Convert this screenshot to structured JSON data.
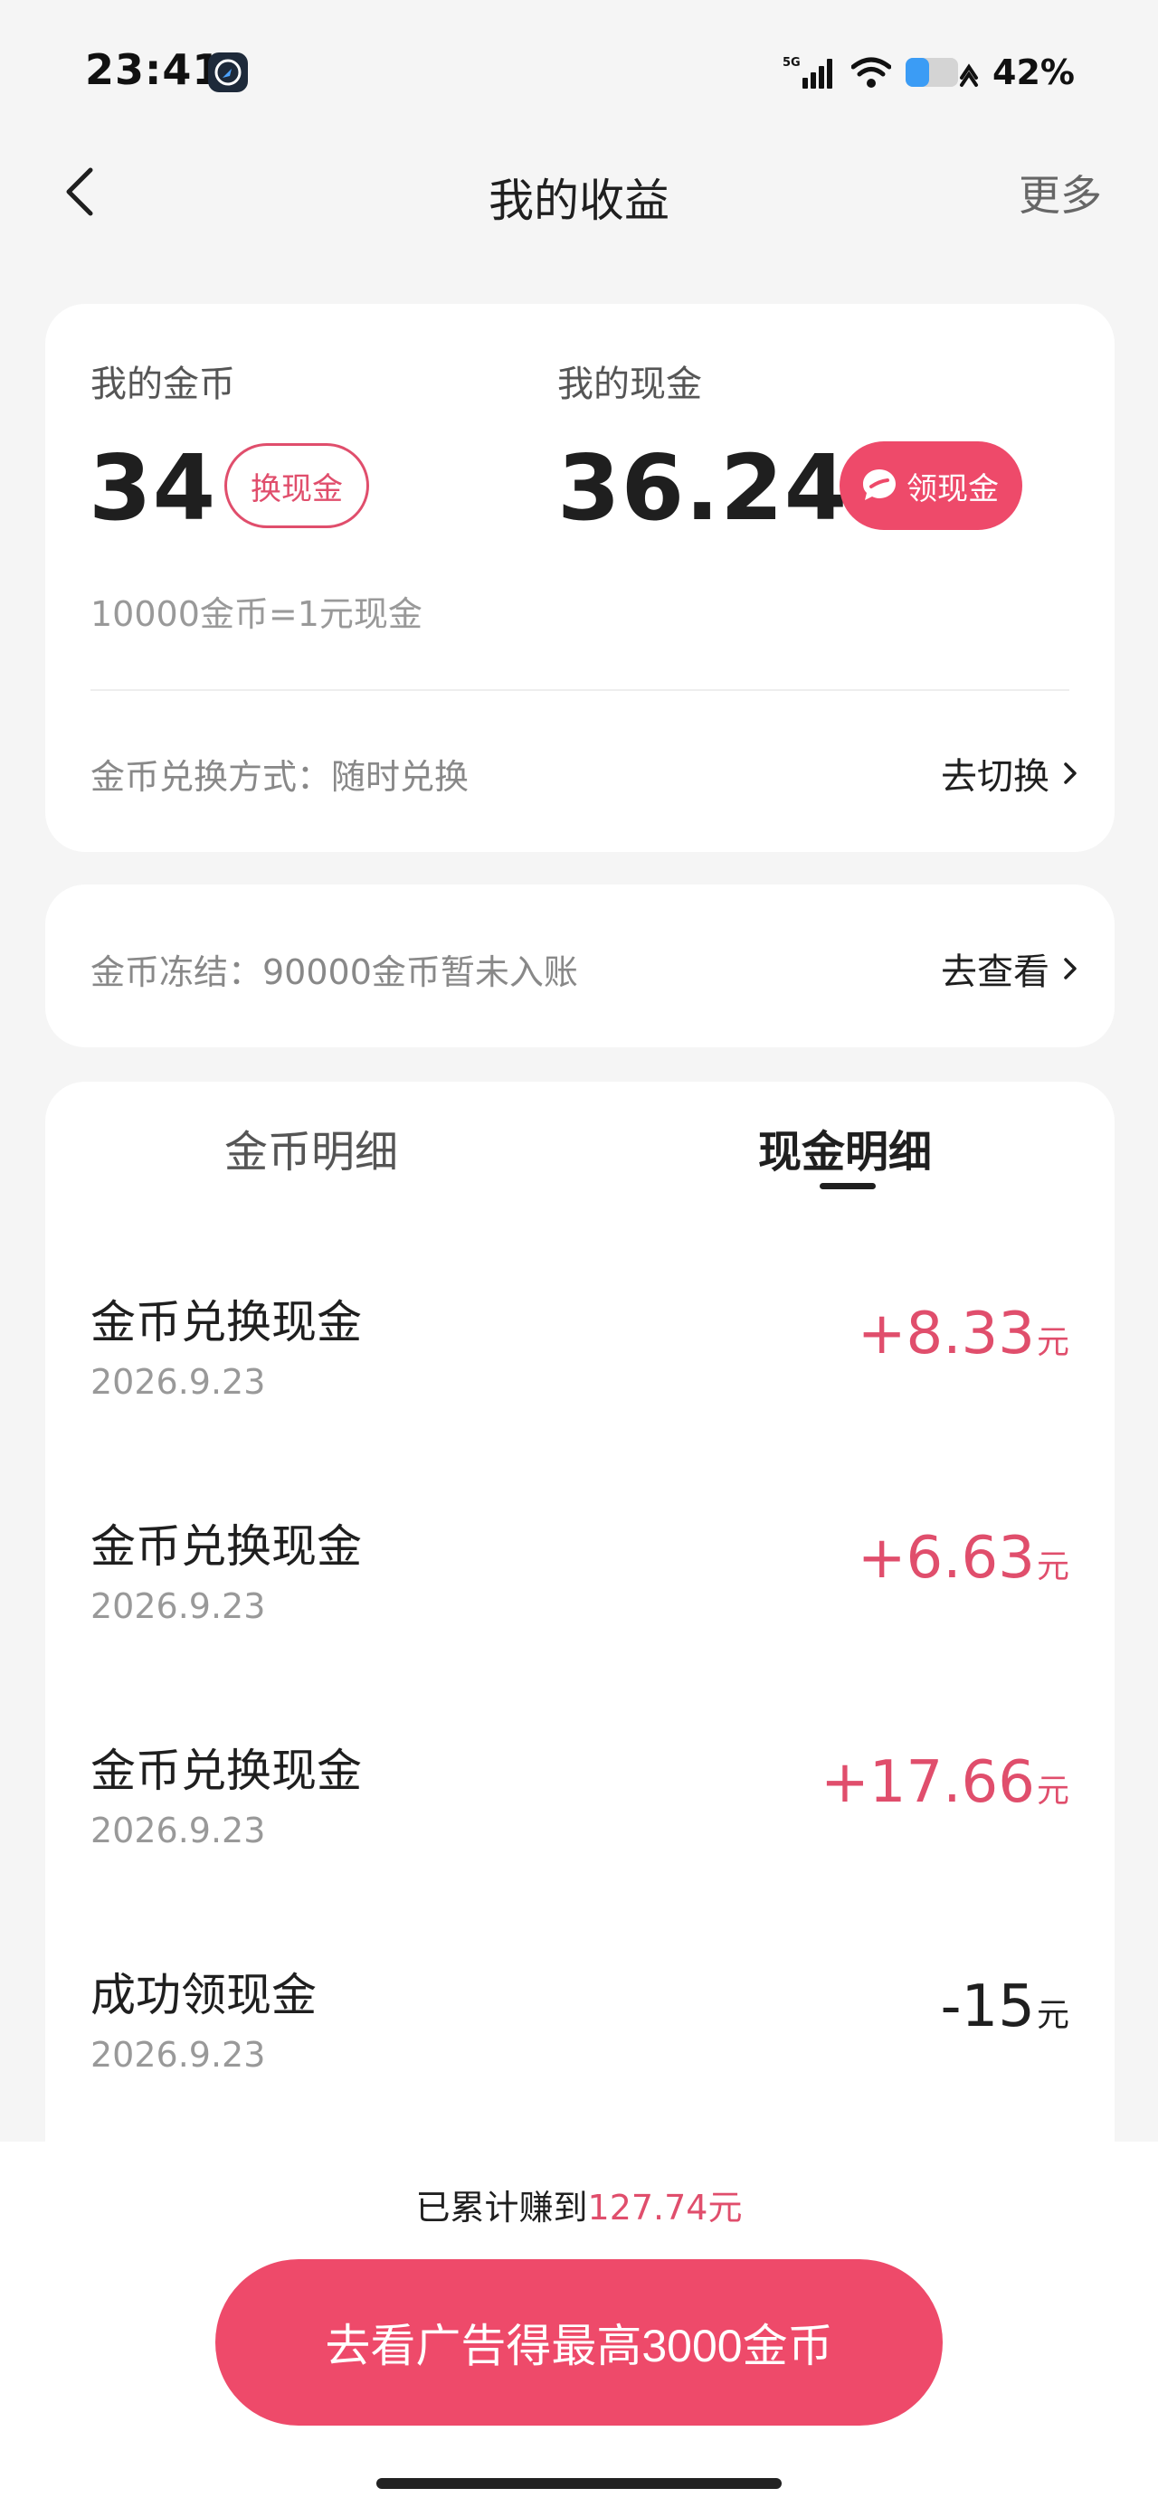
{
  "status_bar": {
    "time": "23:41",
    "network": "5G",
    "battery": "42%",
    "icons": [
      "app-notification-icon",
      "signal-icon",
      "wifi-icon",
      "battery-icon"
    ]
  },
  "nav": {
    "title": "我的收益",
    "more": "更多",
    "back_icon": "back-arrow-icon"
  },
  "coins": {
    "label": "我的金币",
    "value": "34",
    "button": "换现金"
  },
  "cash": {
    "label": "我的现金",
    "value": "36.24",
    "button": "领现金",
    "button_icon": "chat-bubble-icon"
  },
  "rate": "10000金币=1元现金",
  "exchange": {
    "label": "金币兑换方式：随时兑换",
    "action": "去切换"
  },
  "frozen": {
    "label": "金币冻结：90000金币暂未入账",
    "action": "去查看"
  },
  "tabs": [
    {
      "label": "金币明细",
      "active": false
    },
    {
      "label": "现金明细",
      "active": true
    }
  ],
  "records": [
    {
      "title": "金币兑换现金",
      "date": "2026.9.23",
      "amount": "+8.33",
      "unit": "元"
    },
    {
      "title": "金币兑换现金",
      "date": "2026.9.23",
      "amount": "+6.63",
      "unit": "元"
    },
    {
      "title": "金币兑换现金",
      "date": "2026.9.23",
      "amount": "+17.66",
      "unit": "元"
    },
    {
      "title": "成功领现金",
      "date": "2026.9.23",
      "amount": "-15",
      "unit": "元"
    }
  ],
  "footer": {
    "earned_prefix": "已累计赚到",
    "earned_value": "127.74元",
    "cta": "去看广告得最高3000金币"
  },
  "colors": {
    "accent": "#ee4a6a",
    "accent_text": "#e04e6c",
    "background": "#f5f5f5"
  }
}
